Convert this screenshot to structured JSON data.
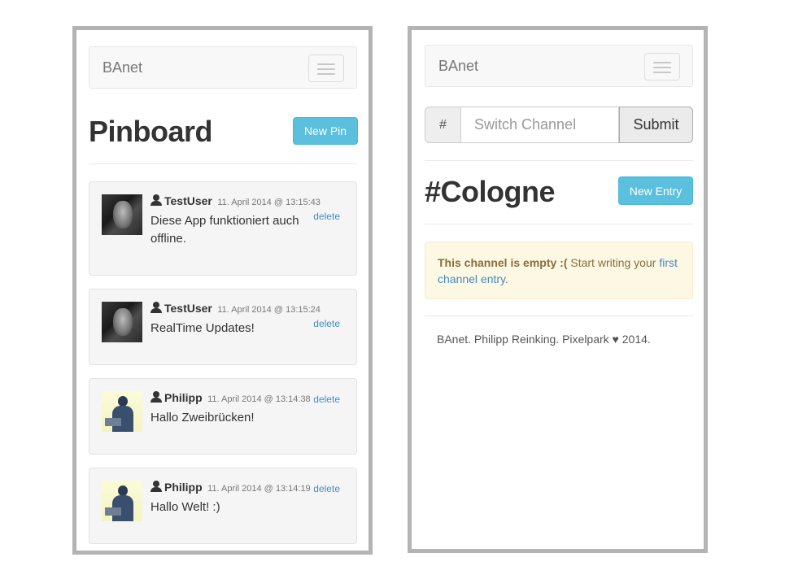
{
  "left_screen": {
    "navbar": {
      "brand": "BAnet"
    },
    "title": "Pinboard",
    "new_pin_label": "New Pin",
    "pins": [
      {
        "user": "TestUser",
        "date": "11. April 2014 @ 13:15:43",
        "delete_label": "delete",
        "text": "Diese App funktioniert auch offline.",
        "avatar": "dark-portrait"
      },
      {
        "user": "TestUser",
        "date": "11. April 2014 @ 13:15:24",
        "delete_label": "delete",
        "text": "RealTime Updates!",
        "avatar": "dark-portrait"
      },
      {
        "user": "Philipp",
        "date": "11. April 2014 @ 13:14:38",
        "delete_label": "delete",
        "text": "Hallo Zweibrücken!",
        "avatar": "laptop-user"
      },
      {
        "user": "Philipp",
        "date": "11. April 2014 @ 13:14:19",
        "delete_label": "delete",
        "text": "Hallo Welt! :)",
        "avatar": "laptop-user"
      }
    ]
  },
  "right_screen": {
    "navbar": {
      "brand": "BAnet"
    },
    "channel_form": {
      "addon": "#",
      "placeholder": "Switch Channel",
      "submit_label": "Submit"
    },
    "title": "#Cologne",
    "new_entry_label": "New Entry",
    "alert": {
      "strong": "This channel is empty :(",
      "text": " Start writing your ",
      "link": "first channel entry",
      "end": "."
    },
    "footer": "BAnet. Philipp Reinking. Pixelpark ♥ 2014."
  },
  "colors": {
    "info": "#5bc0de",
    "link": "#428bca",
    "alert_bg": "#fcf8e3",
    "alert_text": "#8a6d3b"
  }
}
